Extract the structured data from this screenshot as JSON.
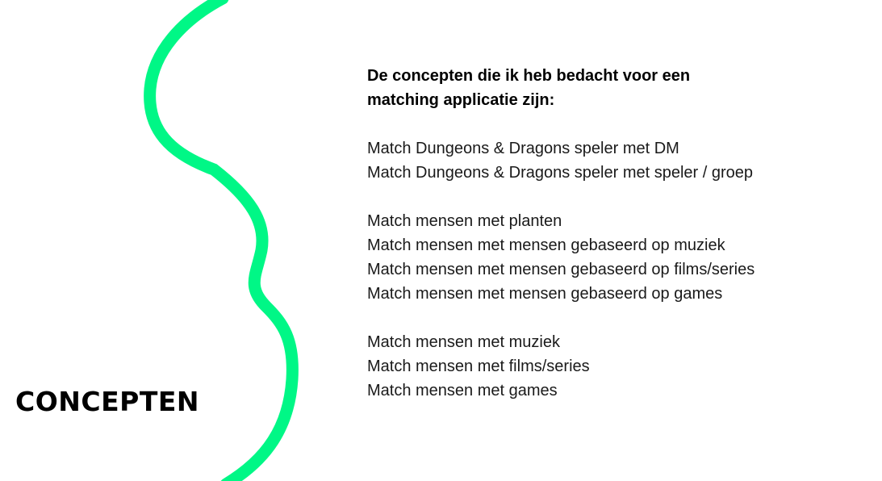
{
  "slide": {
    "title": "CONCEPTEN",
    "accent_color": "#00f786",
    "decoration": "wavy-line"
  },
  "content": {
    "intro_lines": [
      "De concepten die ik heb bedacht voor een",
      "matching applicatie zijn:"
    ],
    "groups": [
      {
        "items": [
          "Match Dungeons & Dragons speler met DM",
          "Match Dungeons & Dragons speler met speler / groep"
        ]
      },
      {
        "items": [
          "Match mensen met planten",
          "Match mensen met mensen gebaseerd op muziek",
          "Match mensen met mensen gebaseerd op films/series",
          "Match mensen met mensen gebaseerd op games"
        ]
      },
      {
        "items": [
          "Match mensen met muziek",
          "Match mensen met films/series",
          "Match mensen met games"
        ]
      }
    ]
  }
}
